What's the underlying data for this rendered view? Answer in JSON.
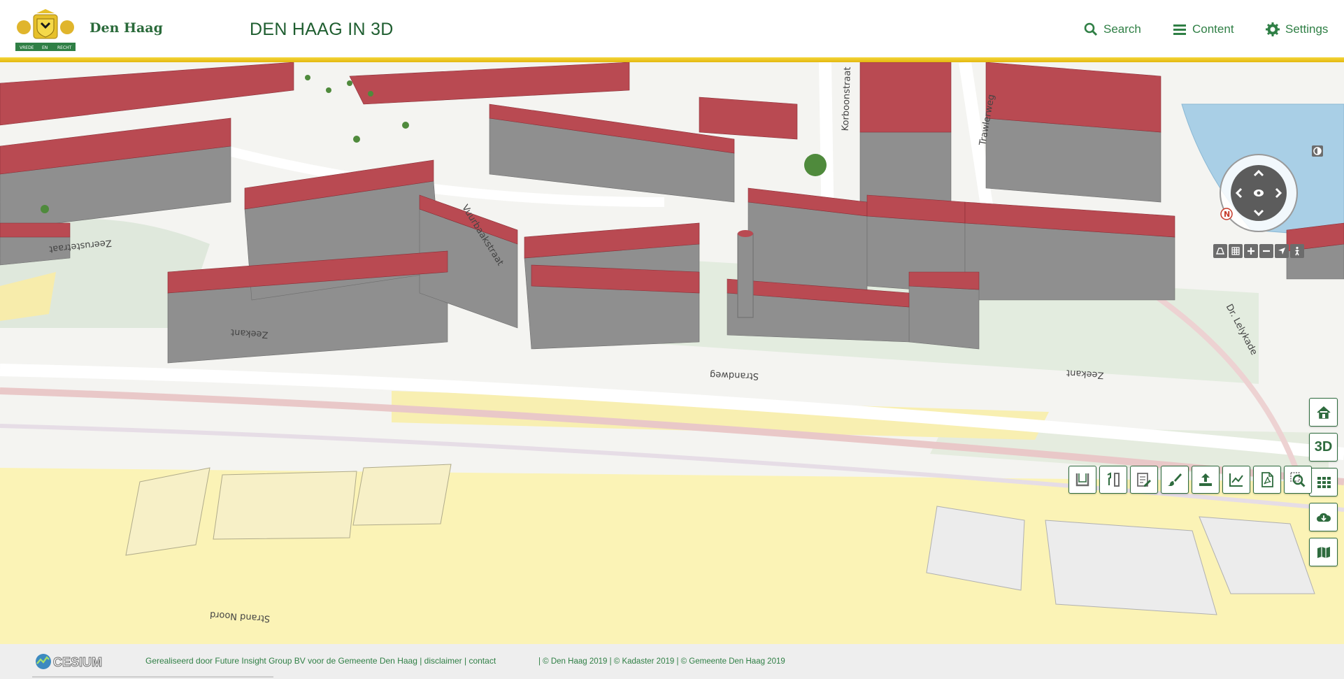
{
  "header": {
    "brand": "Den Haag",
    "app_title": "DEN HAAG IN 3D",
    "nav": {
      "search": "Search",
      "content": "Content",
      "settings": "Settings"
    },
    "logo": {
      "motto_left": "VREDE",
      "motto_center": "EN",
      "motto_right": "RECHT"
    }
  },
  "map": {
    "street_labels": {
      "zeerustetraat": "Zeerustetraat",
      "vuurbaakstraat": "Vuurbaakstraat",
      "zeekant_left": "Zeekant",
      "strandweg": "Strandweg",
      "zeekant_right": "Zeekant",
      "korbootstraat": "Korboonstraat",
      "trawlerweg": "Trawlerweg",
      "dr_lelykade": "Dr. Lelykade",
      "strand_noord": "Strand Noord"
    },
    "compass": {
      "north_label": "N"
    }
  },
  "right_toolbar": {
    "home": "home-icon",
    "mode_label": "3D",
    "layers": "grid-icon",
    "download": "cloud-download-icon",
    "map": "map-icon"
  },
  "tool_row": [
    "ground-profile-icon",
    "measure-icon",
    "edit-icon",
    "paint-icon",
    "upload-icon",
    "chart-icon",
    "pdf-icon",
    "search-zoom-icon"
  ],
  "colors": {
    "brand_green": "#2f7f45",
    "gold_bar": "#e4b80f",
    "roof_red": "#b94a52",
    "wall_grey": "#8f8f8f",
    "beach_yellow": "#fbf3b6",
    "water_blue": "#a9cfe6"
  },
  "footer": {
    "cesium": "CESIUM",
    "credit": "Gerealiseerd door Future Insight Group BV voor de Gemeente Den Haag | disclaimer | contact",
    "copyright": "| © Den Haag 2019 | © Kadaster 2019 | © Gemeente Den Haag 2019"
  }
}
